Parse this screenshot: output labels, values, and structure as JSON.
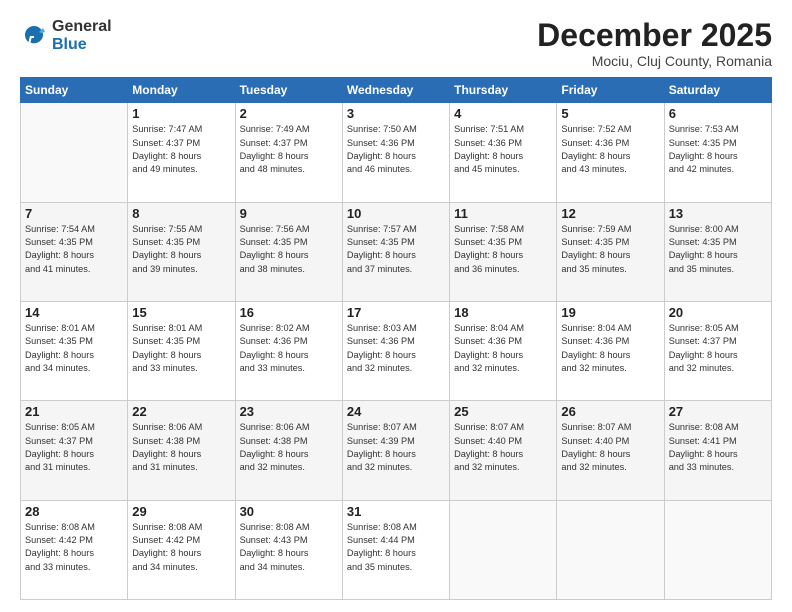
{
  "header": {
    "logo": {
      "general": "General",
      "blue": "Blue"
    },
    "title": "December 2025",
    "location": "Mociu, Cluj County, Romania"
  },
  "weekdays": [
    "Sunday",
    "Monday",
    "Tuesday",
    "Wednesday",
    "Thursday",
    "Friday",
    "Saturday"
  ],
  "weeks": [
    [
      {
        "day": "",
        "sunrise": "",
        "sunset": "",
        "daylight": ""
      },
      {
        "day": "1",
        "sunrise": "Sunrise: 7:47 AM",
        "sunset": "Sunset: 4:37 PM",
        "daylight": "Daylight: 8 hours and 49 minutes."
      },
      {
        "day": "2",
        "sunrise": "Sunrise: 7:49 AM",
        "sunset": "Sunset: 4:37 PM",
        "daylight": "Daylight: 8 hours and 48 minutes."
      },
      {
        "day": "3",
        "sunrise": "Sunrise: 7:50 AM",
        "sunset": "Sunset: 4:36 PM",
        "daylight": "Daylight: 8 hours and 46 minutes."
      },
      {
        "day": "4",
        "sunrise": "Sunrise: 7:51 AM",
        "sunset": "Sunset: 4:36 PM",
        "daylight": "Daylight: 8 hours and 45 minutes."
      },
      {
        "day": "5",
        "sunrise": "Sunrise: 7:52 AM",
        "sunset": "Sunset: 4:36 PM",
        "daylight": "Daylight: 8 hours and 43 minutes."
      },
      {
        "day": "6",
        "sunrise": "Sunrise: 7:53 AM",
        "sunset": "Sunset: 4:35 PM",
        "daylight": "Daylight: 8 hours and 42 minutes."
      }
    ],
    [
      {
        "day": "7",
        "sunrise": "Sunrise: 7:54 AM",
        "sunset": "Sunset: 4:35 PM",
        "daylight": "Daylight: 8 hours and 41 minutes."
      },
      {
        "day": "8",
        "sunrise": "Sunrise: 7:55 AM",
        "sunset": "Sunset: 4:35 PM",
        "daylight": "Daylight: 8 hours and 39 minutes."
      },
      {
        "day": "9",
        "sunrise": "Sunrise: 7:56 AM",
        "sunset": "Sunset: 4:35 PM",
        "daylight": "Daylight: 8 hours and 38 minutes."
      },
      {
        "day": "10",
        "sunrise": "Sunrise: 7:57 AM",
        "sunset": "Sunset: 4:35 PM",
        "daylight": "Daylight: 8 hours and 37 minutes."
      },
      {
        "day": "11",
        "sunrise": "Sunrise: 7:58 AM",
        "sunset": "Sunset: 4:35 PM",
        "daylight": "Daylight: 8 hours and 36 minutes."
      },
      {
        "day": "12",
        "sunrise": "Sunrise: 7:59 AM",
        "sunset": "Sunset: 4:35 PM",
        "daylight": "Daylight: 8 hours and 35 minutes."
      },
      {
        "day": "13",
        "sunrise": "Sunrise: 8:00 AM",
        "sunset": "Sunset: 4:35 PM",
        "daylight": "Daylight: 8 hours and 35 minutes."
      }
    ],
    [
      {
        "day": "14",
        "sunrise": "Sunrise: 8:01 AM",
        "sunset": "Sunset: 4:35 PM",
        "daylight": "Daylight: 8 hours and 34 minutes."
      },
      {
        "day": "15",
        "sunrise": "Sunrise: 8:01 AM",
        "sunset": "Sunset: 4:35 PM",
        "daylight": "Daylight: 8 hours and 33 minutes."
      },
      {
        "day": "16",
        "sunrise": "Sunrise: 8:02 AM",
        "sunset": "Sunset: 4:36 PM",
        "daylight": "Daylight: 8 hours and 33 minutes."
      },
      {
        "day": "17",
        "sunrise": "Sunrise: 8:03 AM",
        "sunset": "Sunset: 4:36 PM",
        "daylight": "Daylight: 8 hours and 32 minutes."
      },
      {
        "day": "18",
        "sunrise": "Sunrise: 8:04 AM",
        "sunset": "Sunset: 4:36 PM",
        "daylight": "Daylight: 8 hours and 32 minutes."
      },
      {
        "day": "19",
        "sunrise": "Sunrise: 8:04 AM",
        "sunset": "Sunset: 4:36 PM",
        "daylight": "Daylight: 8 hours and 32 minutes."
      },
      {
        "day": "20",
        "sunrise": "Sunrise: 8:05 AM",
        "sunset": "Sunset: 4:37 PM",
        "daylight": "Daylight: 8 hours and 32 minutes."
      }
    ],
    [
      {
        "day": "21",
        "sunrise": "Sunrise: 8:05 AM",
        "sunset": "Sunset: 4:37 PM",
        "daylight": "Daylight: 8 hours and 31 minutes."
      },
      {
        "day": "22",
        "sunrise": "Sunrise: 8:06 AM",
        "sunset": "Sunset: 4:38 PM",
        "daylight": "Daylight: 8 hours and 31 minutes."
      },
      {
        "day": "23",
        "sunrise": "Sunrise: 8:06 AM",
        "sunset": "Sunset: 4:38 PM",
        "daylight": "Daylight: 8 hours and 32 minutes."
      },
      {
        "day": "24",
        "sunrise": "Sunrise: 8:07 AM",
        "sunset": "Sunset: 4:39 PM",
        "daylight": "Daylight: 8 hours and 32 minutes."
      },
      {
        "day": "25",
        "sunrise": "Sunrise: 8:07 AM",
        "sunset": "Sunset: 4:40 PM",
        "daylight": "Daylight: 8 hours and 32 minutes."
      },
      {
        "day": "26",
        "sunrise": "Sunrise: 8:07 AM",
        "sunset": "Sunset: 4:40 PM",
        "daylight": "Daylight: 8 hours and 32 minutes."
      },
      {
        "day": "27",
        "sunrise": "Sunrise: 8:08 AM",
        "sunset": "Sunset: 4:41 PM",
        "daylight": "Daylight: 8 hours and 33 minutes."
      }
    ],
    [
      {
        "day": "28",
        "sunrise": "Sunrise: 8:08 AM",
        "sunset": "Sunset: 4:42 PM",
        "daylight": "Daylight: 8 hours and 33 minutes."
      },
      {
        "day": "29",
        "sunrise": "Sunrise: 8:08 AM",
        "sunset": "Sunset: 4:42 PM",
        "daylight": "Daylight: 8 hours and 34 minutes."
      },
      {
        "day": "30",
        "sunrise": "Sunrise: 8:08 AM",
        "sunset": "Sunset: 4:43 PM",
        "daylight": "Daylight: 8 hours and 34 minutes."
      },
      {
        "day": "31",
        "sunrise": "Sunrise: 8:08 AM",
        "sunset": "Sunset: 4:44 PM",
        "daylight": "Daylight: 8 hours and 35 minutes."
      },
      {
        "day": "",
        "sunrise": "",
        "sunset": "",
        "daylight": ""
      },
      {
        "day": "",
        "sunrise": "",
        "sunset": "",
        "daylight": ""
      },
      {
        "day": "",
        "sunrise": "",
        "sunset": "",
        "daylight": ""
      }
    ]
  ]
}
